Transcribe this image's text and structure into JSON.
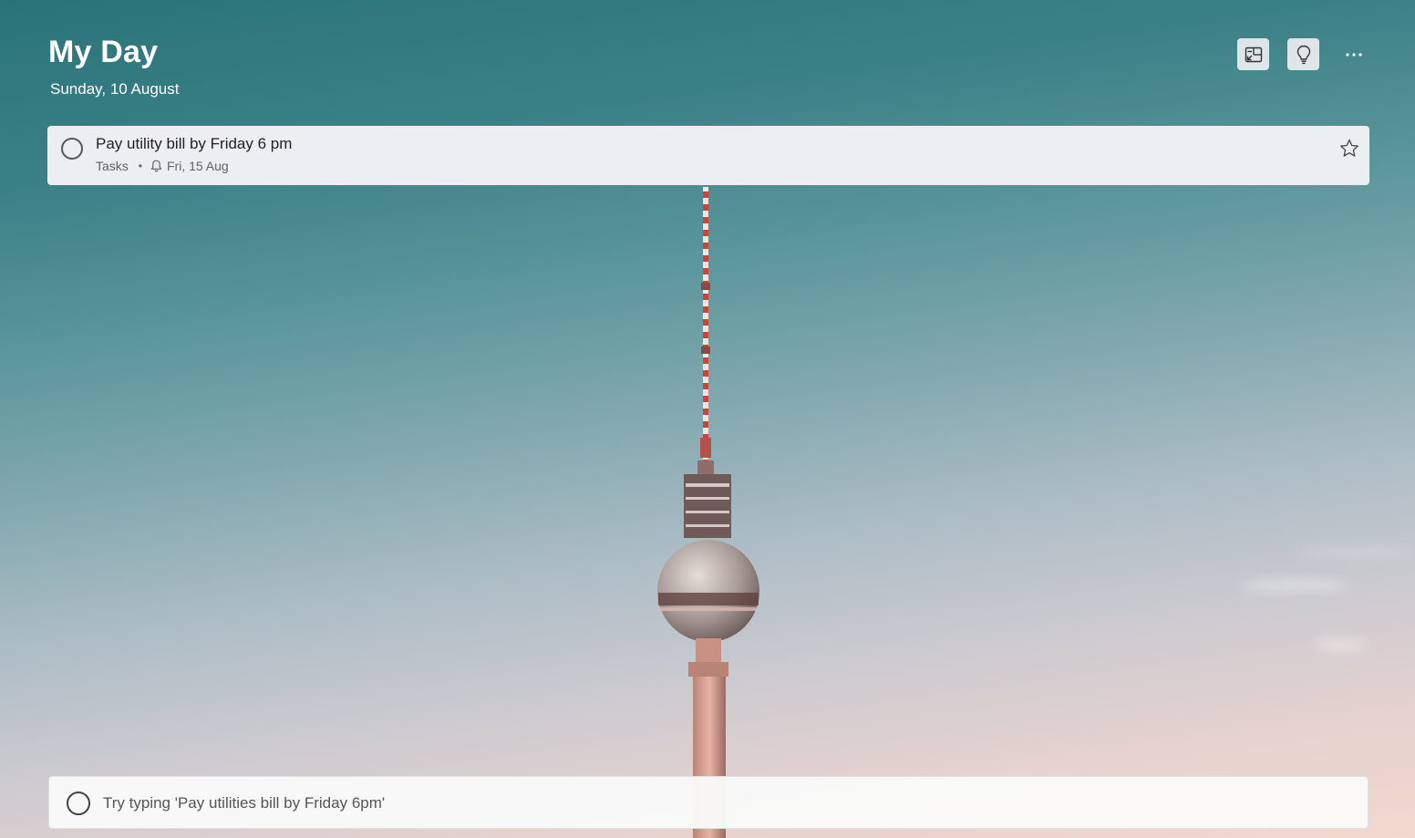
{
  "header": {
    "title": "My Day",
    "date": "Sunday, 10 August",
    "buttons": {
      "background_icon": "change-background-icon",
      "suggestions_icon": "lightbulb-icon",
      "more_icon": "more-options-icon"
    }
  },
  "tasks": [
    {
      "title": "Pay utility bill by Friday 6 pm",
      "list": "Tasks",
      "separator": "•",
      "reminder": "Fri, 15 Aug",
      "reminder_icon": "bell-icon",
      "important_icon": "star-icon",
      "completed": false
    }
  ],
  "add_task": {
    "placeholder": "Try typing 'Pay utilities bill by Friday 6pm'",
    "value": ""
  },
  "colors": {
    "sky_top": "#2a7479",
    "sky_bottom": "#f2d8cf",
    "card_bg": "#ebeff1",
    "text_dark": "#222222"
  }
}
